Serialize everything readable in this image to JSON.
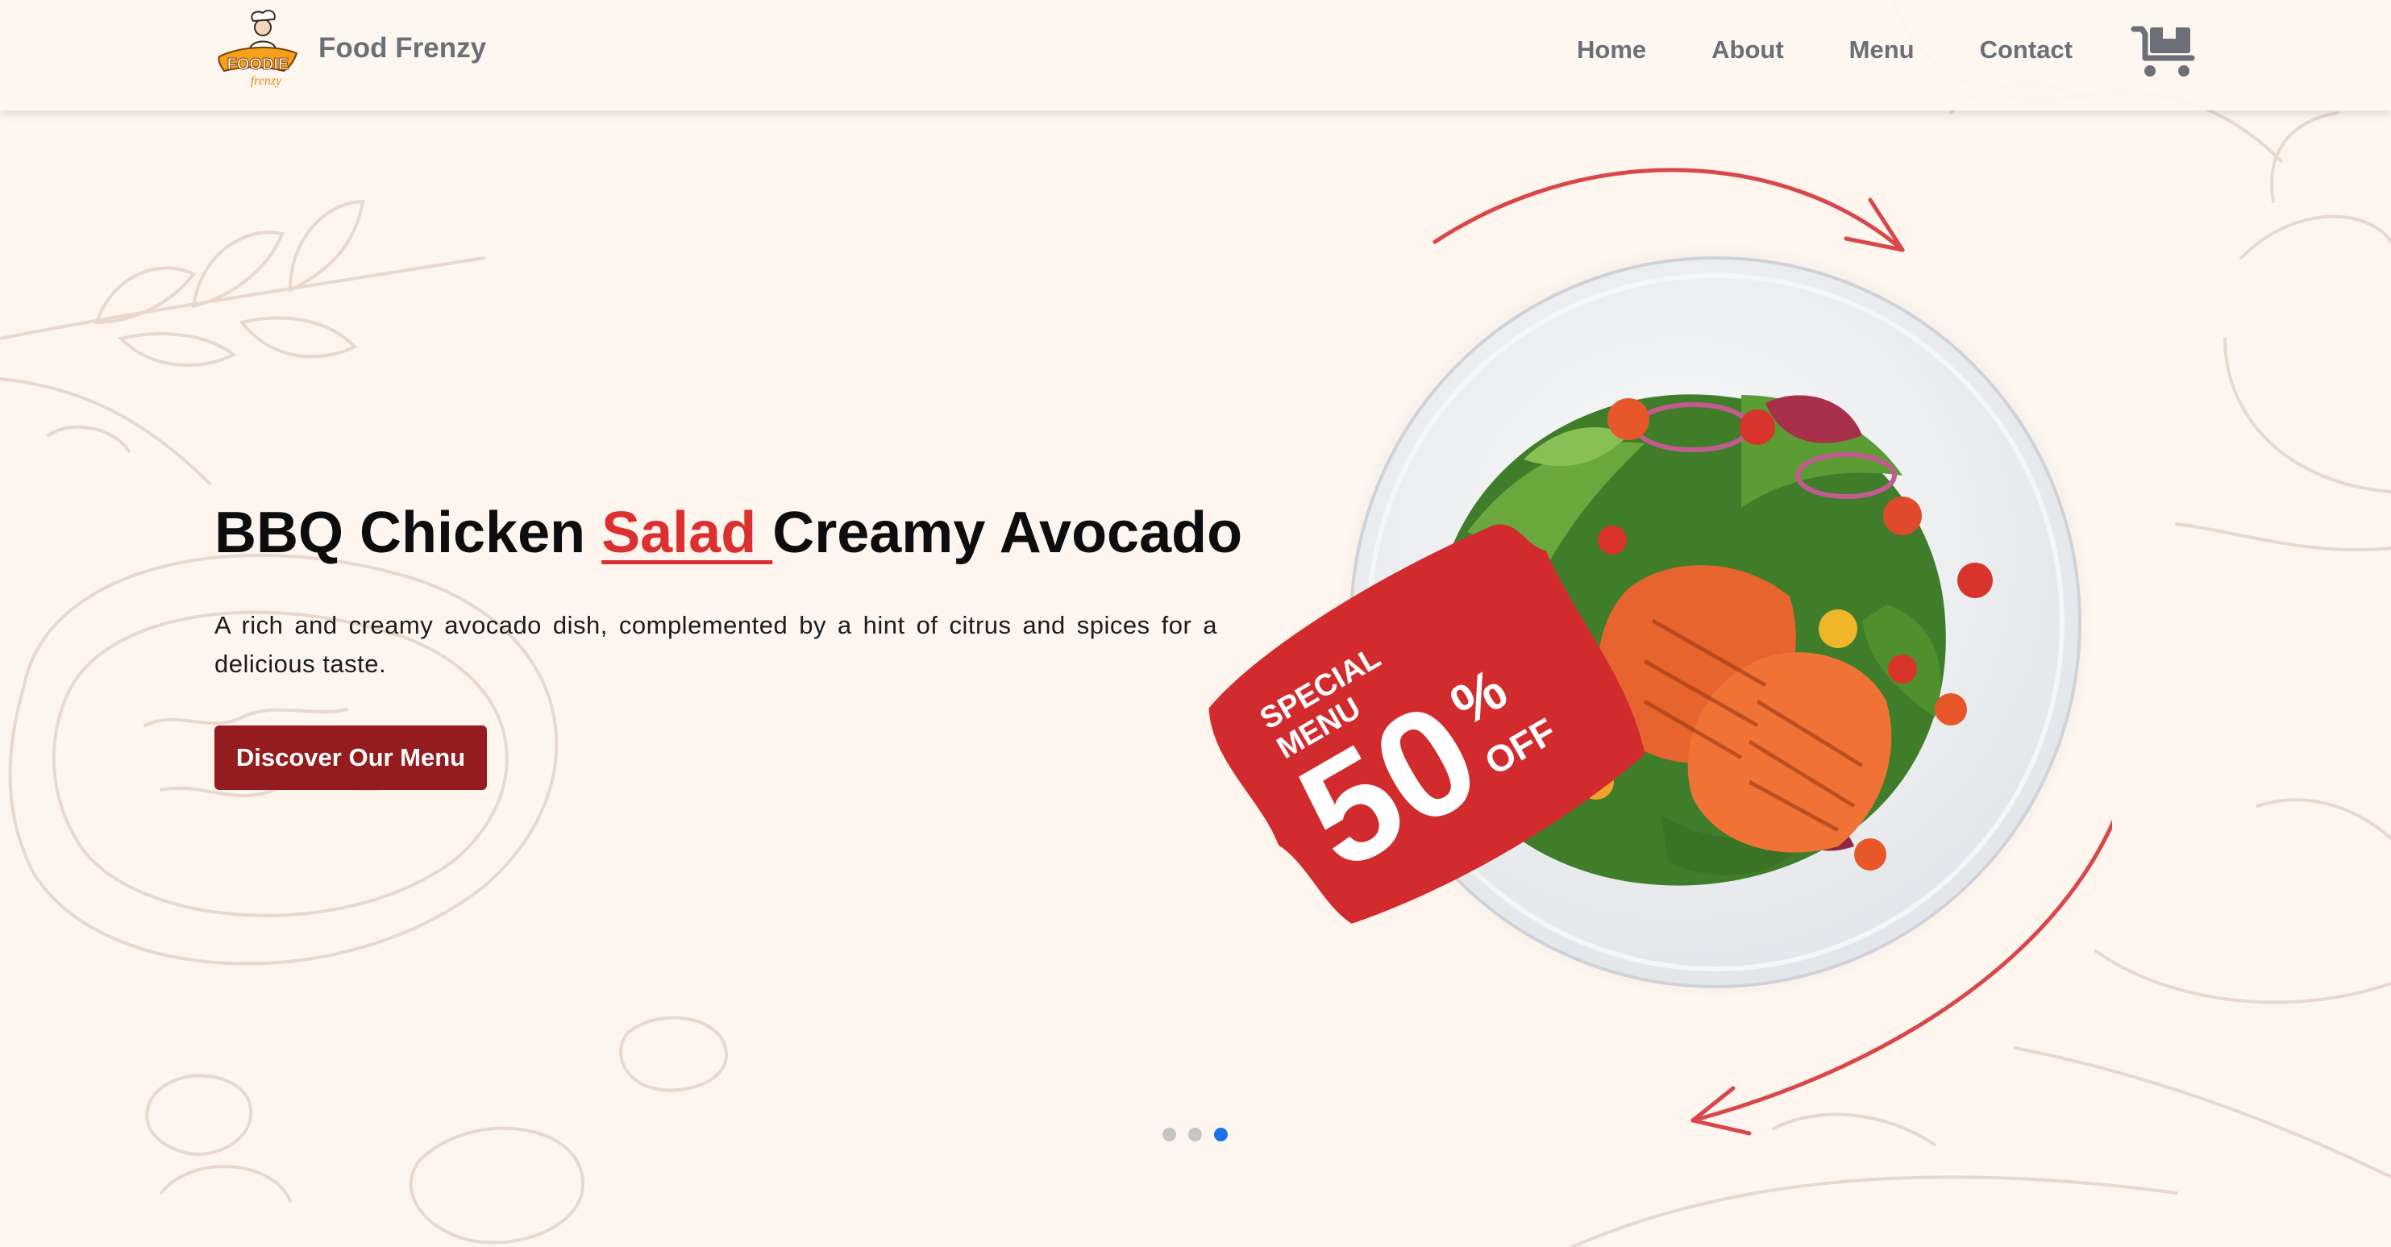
{
  "header": {
    "logo_text": "FOODIE frenzy",
    "brand": "Food Frenzy",
    "nav": [
      "Home",
      "About",
      "Menu",
      "Contact"
    ]
  },
  "hero": {
    "title_before": "BBQ Chicken ",
    "title_accent": "Salad ",
    "title_after": "Creamy Avocado",
    "description": "A rich and creamy avocado dish, complemented by a hint of citrus and spices for a delicious taste.",
    "cta_label": "Discover Our Menu"
  },
  "badge": {
    "line1": "SPECIAL",
    "line2": "MENU",
    "value": "50",
    "percent": "%",
    "off": "OFF"
  },
  "slider": {
    "total": 3,
    "active_index": 2
  },
  "colors": {
    "background": "#fdf5ee",
    "accent": "#dc2f2f",
    "button": "#941b1e",
    "nav_text": "#6b6f78",
    "dot_active": "#1a73e8"
  },
  "icons": [
    "cart-icon"
  ]
}
